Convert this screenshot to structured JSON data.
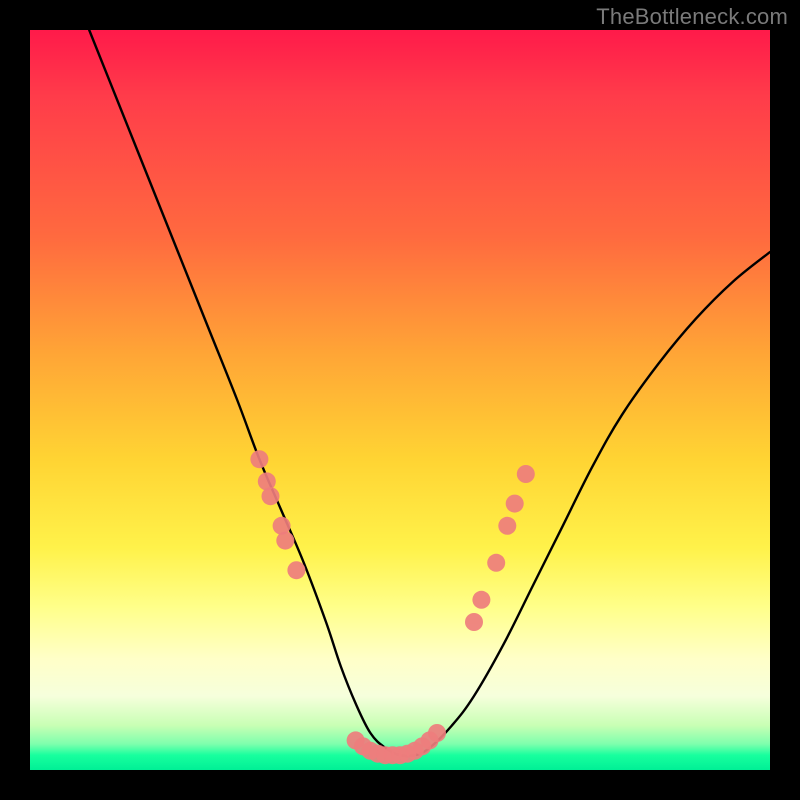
{
  "watermark": "TheBottleneck.com",
  "chart_data": {
    "type": "line",
    "title": "",
    "xlabel": "",
    "ylabel": "",
    "xlim": [
      0,
      100
    ],
    "ylim": [
      0,
      100
    ],
    "grid": false,
    "legend": false,
    "series": [
      {
        "name": "bottleneck-curve",
        "x": [
          8,
          12,
          16,
          20,
          24,
          28,
          31,
          34,
          37,
          40,
          42,
          44,
          46,
          48,
          50,
          52,
          54,
          57,
          60,
          64,
          68,
          72,
          76,
          80,
          85,
          90,
          95,
          100
        ],
        "y": [
          100,
          90,
          80,
          70,
          60,
          50,
          42,
          35,
          28,
          20,
          14,
          9,
          5,
          3,
          2,
          2,
          3,
          6,
          10,
          17,
          25,
          33,
          41,
          48,
          55,
          61,
          66,
          70
        ]
      }
    ],
    "markers": {
      "name": "highlight-dots",
      "color": "#ee7d7d",
      "radius_px": 9,
      "points": [
        {
          "x": 31.0,
          "y": 42
        },
        {
          "x": 32.0,
          "y": 39
        },
        {
          "x": 32.5,
          "y": 37
        },
        {
          "x": 34.0,
          "y": 33
        },
        {
          "x": 34.5,
          "y": 31
        },
        {
          "x": 36.0,
          "y": 27
        },
        {
          "x": 44.0,
          "y": 4.0
        },
        {
          "x": 45.0,
          "y": 3.2
        },
        {
          "x": 46.0,
          "y": 2.6
        },
        {
          "x": 47.0,
          "y": 2.2
        },
        {
          "x": 48.0,
          "y": 2.0
        },
        {
          "x": 49.0,
          "y": 2.0
        },
        {
          "x": 50.0,
          "y": 2.0
        },
        {
          "x": 51.0,
          "y": 2.2
        },
        {
          "x": 52.0,
          "y": 2.6
        },
        {
          "x": 53.0,
          "y": 3.2
        },
        {
          "x": 54.0,
          "y": 4.0
        },
        {
          "x": 55.0,
          "y": 5.0
        },
        {
          "x": 60.0,
          "y": 20
        },
        {
          "x": 61.0,
          "y": 23
        },
        {
          "x": 63.0,
          "y": 28
        },
        {
          "x": 64.5,
          "y": 33
        },
        {
          "x": 65.5,
          "y": 36
        },
        {
          "x": 67.0,
          "y": 40
        }
      ]
    },
    "background_gradient_stops": [
      {
        "pos": 0,
        "color": "#ff1a4a"
      },
      {
        "pos": 28,
        "color": "#ff6a3f"
      },
      {
        "pos": 58,
        "color": "#ffd433"
      },
      {
        "pos": 85,
        "color": "#ffffc8"
      },
      {
        "pos": 100,
        "color": "#00f096"
      }
    ]
  }
}
